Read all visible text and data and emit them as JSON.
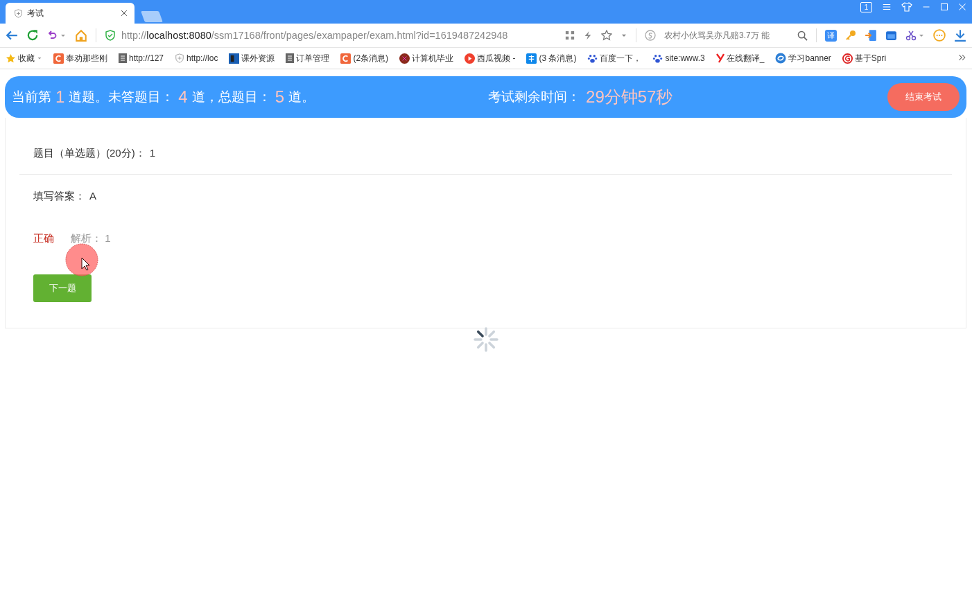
{
  "browser": {
    "tab": {
      "title": "考试",
      "selected": true
    },
    "window_badge": "1",
    "url": {
      "scheme": "http://",
      "host": "localhost:8080",
      "path": "/ssm17168/front/pages/exampaper/exam.html?id=1619487242948"
    },
    "search": {
      "placeholder": "农村小伙骂吴亦凡赔3.7万 能"
    },
    "translate_label": "译",
    "bookmarks": [
      {
        "label": "收藏",
        "kind": "star"
      },
      {
        "label": "奉劝那些刚",
        "kind": "c"
      },
      {
        "label": "http://127",
        "kind": "doc"
      },
      {
        "label": "http://loc",
        "kind": "shield"
      },
      {
        "label": "课外资源",
        "kind": "blue"
      },
      {
        "label": "订单管理",
        "kind": "doc"
      },
      {
        "label": "(2条消息)",
        "kind": "c"
      },
      {
        "label": "计算机毕业",
        "kind": "maroon"
      },
      {
        "label": "西瓜视频 -",
        "kind": "play"
      },
      {
        "label": "(3 条消息)",
        "kind": "zhi"
      },
      {
        "label": "百度一下，",
        "kind": "paw"
      },
      {
        "label": "site:www.3",
        "kind": "paw"
      },
      {
        "label": "在线翻译_",
        "kind": "y"
      },
      {
        "label": "学习banner",
        "kind": "swirl"
      },
      {
        "label": "基于Spri",
        "kind": "g"
      }
    ]
  },
  "exam_header": {
    "status": [
      {
        "kind": "text",
        "text": "当前第"
      },
      {
        "kind": "number",
        "text": "1"
      },
      {
        "kind": "text",
        "text": "道题。未答题目："
      },
      {
        "kind": "number",
        "text": "4"
      },
      {
        "kind": "text",
        "text": "道，总题目："
      },
      {
        "kind": "number",
        "text": "5"
      },
      {
        "kind": "text",
        "text": "道。"
      }
    ],
    "timer_label": "考试剩余时间：",
    "timer_value": "29分钟57秒",
    "end_button": "结束考试"
  },
  "question": {
    "label": "题目（单选题）(20分)：",
    "text": "1"
  },
  "answer": {
    "label": "填写答案：",
    "value": "A"
  },
  "result": {
    "verdict": "正确",
    "correct": true,
    "analysis_label": "解析：",
    "analysis": "1"
  },
  "next_button": "下一题"
}
